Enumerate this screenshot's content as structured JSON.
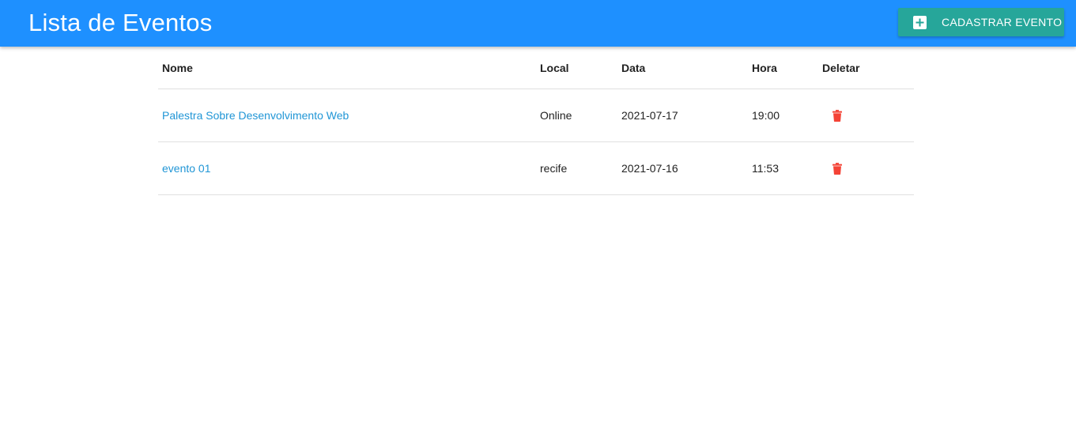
{
  "header": {
    "title": "Lista de Eventos",
    "add_button_label": "CADASTRAR EVENTO",
    "add_icon": "add-box-icon",
    "background_color": "#1e90ff",
    "button_color": "#26a69a"
  },
  "table": {
    "columns": [
      "Nome",
      "Local",
      "Data",
      "Hora",
      "Deletar"
    ],
    "rows": [
      {
        "nome": "Palestra Sobre Desenvolvimento Web",
        "local": "Online",
        "data": "2021-07-17",
        "hora": "19:00",
        "delete_icon": "trash-icon"
      },
      {
        "nome": "evento 01",
        "local": "recife",
        "data": "2021-07-16",
        "hora": "11:53",
        "delete_icon": "trash-icon"
      }
    ],
    "link_color": "#2196d6",
    "delete_color": "#f44336"
  }
}
